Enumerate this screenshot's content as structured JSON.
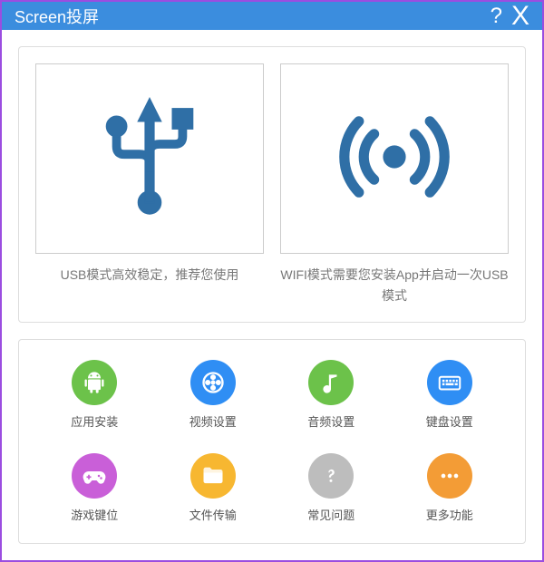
{
  "title": "Screen投屏",
  "help_char": "?",
  "close_char": "X",
  "modes": {
    "usb": {
      "desc": "USB模式高效稳定，推荐您使用"
    },
    "wifi": {
      "desc": "WIFI模式需要您安装App并启动一次USB模式"
    }
  },
  "tools": {
    "app_install": "应用安装",
    "video_settings": "视频设置",
    "audio_settings": "音频设置",
    "keyboard_settings": "键盘设置",
    "game_keys": "游戏键位",
    "file_transfer": "文件传输",
    "faq": "常见问题",
    "more": "更多功能"
  },
  "colors": {
    "green": "#6cc24a",
    "blue": "#2f8ef4",
    "magenta": "#c95fd8",
    "yellow": "#f7b731",
    "grey": "#bdbdbd",
    "orange": "#f39c36"
  }
}
